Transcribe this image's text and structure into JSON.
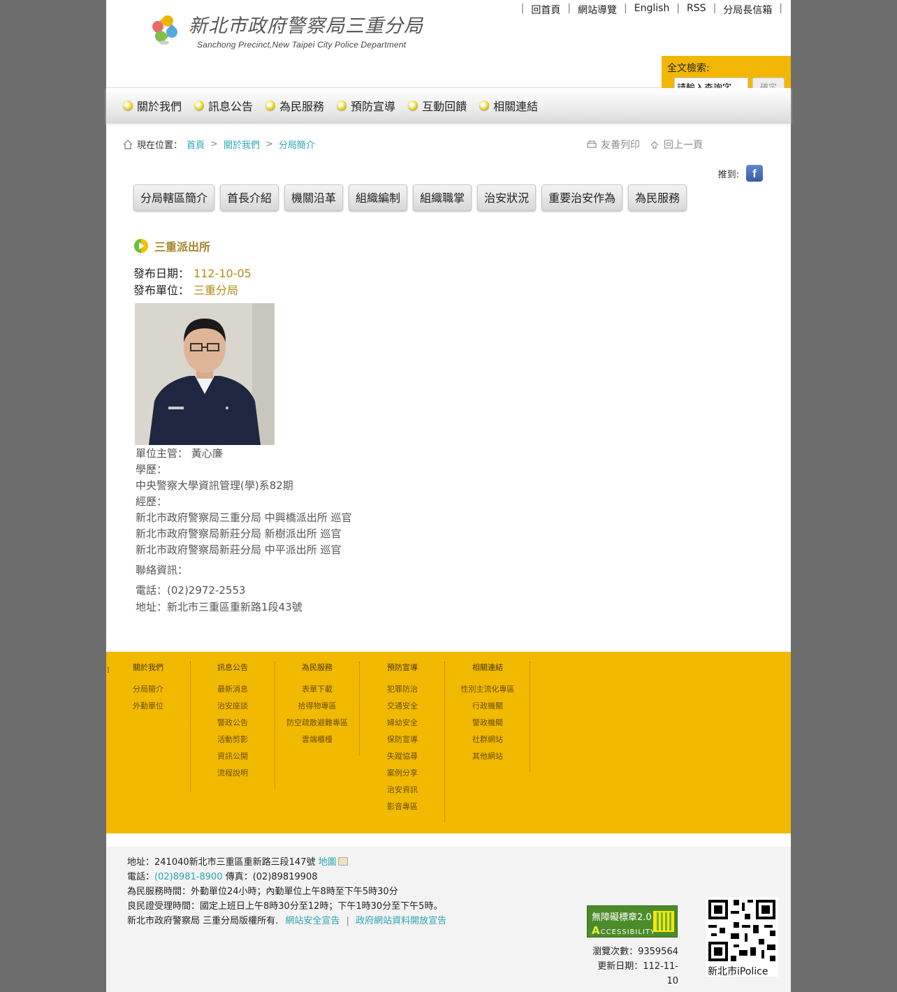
{
  "header": {
    "title_zh": "新北市政府警察局三重分局",
    "title_en": "Sanchong Precinct,New Taipei City Police Department",
    "top_links": [
      "回首頁",
      "網站導覽",
      "English",
      "RSS",
      "分局長信箱"
    ],
    "search": {
      "label": "全文檢索:",
      "placeholder": "請輸入查詢字",
      "button": "確定"
    }
  },
  "nav": [
    "關於我們",
    "訊息公告",
    "為民服務",
    "預防宣導",
    "互動回饋",
    "相關連結"
  ],
  "breadcrumb": {
    "prefix": "現在位置：",
    "items": [
      "首頁",
      "關於我們",
      "分局簡介"
    ],
    "sep": ">"
  },
  "tools": {
    "print": "友善列印",
    "back": "回上一頁",
    "share_label": "推到:"
  },
  "subtabs": [
    "分局轄區簡介",
    "首長介紹",
    "機關沿革",
    "組織編制",
    "組織職掌",
    "治安狀況",
    "重要治安作為",
    "為民服務"
  ],
  "article": {
    "title": "三重派出所",
    "date_label": "發布日期：",
    "date": "112-10-05",
    "unit_label": "發布單位：",
    "unit": "三重分局",
    "bio": [
      "單位主管： 黃心廉",
      "學歷：",
      "中央警察大學資訊管理(學)系82期",
      "經歷：",
      "新北市政府警察局三重分局 中興橋派出所 巡官",
      "新北市政府警察局新莊分局 新樹派出所 巡官",
      "新北市政府警察局新莊分局 中平派出所 巡官"
    ],
    "contact_label": "聯絡資訊：",
    "phone": "電話：(02)2972-2553",
    "address": "地址：新北市三重區重新路1段43號"
  },
  "footer_nav": [
    {
      "heading": "關於我們",
      "items": [
        "分局簡介",
        "外勤單位"
      ]
    },
    {
      "heading": "訊息公告",
      "items": [
        "最新消息",
        "治安座談",
        "警政公告",
        "活動剪影",
        "資訊公開",
        "流程說明"
      ]
    },
    {
      "heading": "為民服務",
      "items": [
        "表單下載",
        "拾得物專區",
        "防空疏散避難專區",
        "雲端櫃檯"
      ]
    },
    {
      "heading": "預防宣導",
      "items": [
        "犯罪防治",
        "交通安全",
        "婦幼安全",
        "保防宣導",
        "失蹤協尋",
        "案例分享",
        "治安資訊",
        "影音專區"
      ]
    },
    {
      "heading": "相關連結",
      "items": [
        "性別主流化專區",
        "行政機關",
        "警政機關",
        "社群網站",
        "其他網站"
      ]
    }
  ],
  "bottom": {
    "address": "地址：241040新北市三重區重新路三段147號",
    "map_link": "地圖",
    "phone_label": "電話：",
    "phone": "(02)8981-8900",
    "fax": "傳真：(02)89819908",
    "hours": "為民服務時間：外勤單位24小時；內勤單位上午8時至下午5時30分",
    "cert_hours": "良民證受理時間：國定上班日上午8時30分至12時；下午1時30分至下午5時。",
    "copyright": "新北市政府警察局 三重分局版權所有.",
    "security_link": "網站安全宣告",
    "open_data_link": "政府網站資料開放宣告",
    "accessibility_line1": "無障礙標章2.0",
    "accessibility_line2_initial": "A",
    "accessibility_line2_rest": "CCESSIBILITY",
    "views": "瀏覽次數：9359564",
    "updated": "更新日期：112-11-10",
    "qr_label": "新北市iPolice"
  },
  "colors": {
    "accent": "#f1b900",
    "link": "#2aa5b5",
    "date": "#b38b13"
  }
}
